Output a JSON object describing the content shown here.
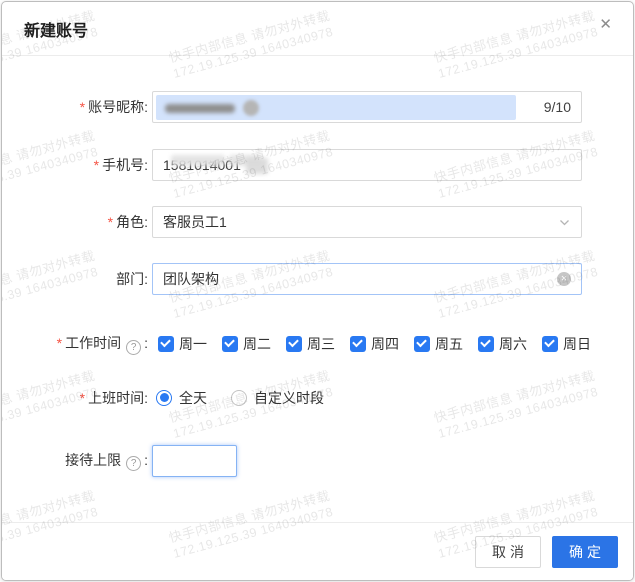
{
  "dialog": {
    "title": "新建账号"
  },
  "icons": {
    "close": "✕",
    "help": "?",
    "clear": "✕"
  },
  "marks": {
    "required": "*",
    "colon": ":"
  },
  "watermark": {
    "line1": "快手内部信息 请勿对外转载",
    "line2": "172.19.125.39 1640340978"
  },
  "form": {
    "nickname": {
      "label": "账号昵称",
      "required": true,
      "redacted": true,
      "counter": "9/10"
    },
    "phone": {
      "label": "手机号",
      "required": true,
      "value": "1581014001",
      "partially_redacted": true
    },
    "role": {
      "label": "角色",
      "required": true,
      "value": "客服员工1"
    },
    "department": {
      "label": "部门",
      "value": "团队架构",
      "clearable": true
    },
    "work_days": {
      "label": "工作时间",
      "required": true,
      "has_help": true,
      "options": [
        {
          "label": "周一",
          "checked": true
        },
        {
          "label": "周二",
          "checked": true
        },
        {
          "label": "周三",
          "checked": true
        },
        {
          "label": "周四",
          "checked": true
        },
        {
          "label": "周五",
          "checked": true
        },
        {
          "label": "周六",
          "checked": true
        },
        {
          "label": "周日",
          "checked": true
        }
      ]
    },
    "shift_time": {
      "label": "上班时间",
      "required": true,
      "options": [
        {
          "label": "全天",
          "selected": true
        },
        {
          "label": "自定义时段",
          "selected": false
        }
      ]
    },
    "reception_limit": {
      "label": "接待上限",
      "has_help": true,
      "value": "",
      "focused": true
    }
  },
  "footer": {
    "cancel_label": "取消",
    "confirm_label": "确定"
  },
  "colors": {
    "primary": "#2979f2",
    "confirm_button": "#2b74e6",
    "selection_highlight": "#d3e3fc",
    "required_mark": "#f55445"
  }
}
